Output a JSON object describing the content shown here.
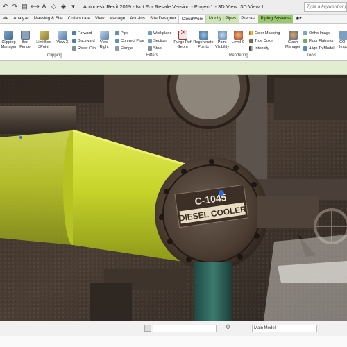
{
  "window": {
    "title": "Autodesk Revit 2019 - Not For Resale Version - Project1 - 3D View: 3D View 1",
    "search_placeholder": "Type a keyword or phrase"
  },
  "tabs": [
    {
      "label": "ate",
      "kind": "normal"
    },
    {
      "label": "Analyze",
      "kind": "normal"
    },
    {
      "label": "Massing & Site",
      "kind": "normal"
    },
    {
      "label": "Collaborate",
      "kind": "normal"
    },
    {
      "label": "View",
      "kind": "normal"
    },
    {
      "label": "Manage",
      "kind": "normal"
    },
    {
      "label": "Add-Ins",
      "kind": "normal"
    },
    {
      "label": "Site Designer",
      "kind": "normal"
    },
    {
      "label": "CloudWorx",
      "kind": "active"
    },
    {
      "label": "Modify | Pipes",
      "kind": "ctx"
    },
    {
      "label": "Precast",
      "kind": "normal"
    },
    {
      "label": "Piping Systems",
      "kind": "ctx2"
    }
  ],
  "ribbon": {
    "clipping_manager": "Clipping Manager",
    "box_fence": "Box Fence",
    "limitbox_3point": "LimitBox 3Point",
    "view_x": "View X",
    "forward": "Forward",
    "backward": "Backward",
    "reset_clip": "Reset Clip",
    "view_right": "View Right",
    "pipe": "Pipe",
    "connect_pipe": "Connect Pipe",
    "flange": "Flange",
    "workplane": "Workplane",
    "section": "Section",
    "steel": "Steel",
    "purge_ref_geom": "Purge Ref Geom",
    "regenerate_points": "Regenerate Points",
    "point_visibility": "Point Visibility",
    "level_0": "Level 0",
    "color_mapping": "Color Mapping",
    "true_color": "True Color",
    "intensity": "Intensity",
    "clash_manager": "Clash Manager",
    "ortho_image": "Ortho Image",
    "floor_flatness": "Floor Flatness",
    "align_to_model": "Align To Model",
    "co_import": "CO Impo",
    "groups": {
      "clipping": "Clipping",
      "fitters": "Fitters",
      "rendering": "Rendering",
      "tools": "Tools"
    }
  },
  "viewport": {
    "tag_line1": "C-1045",
    "tag_line2": "DIESEL COOLER"
  },
  "status": {
    "scale_value": "0",
    "model_selector": "Main Model"
  },
  "colors": {
    "context_tab_light": "#cfe7b4",
    "context_tab_dark": "#98c96c",
    "selected_pipe": "#c8d62a"
  }
}
